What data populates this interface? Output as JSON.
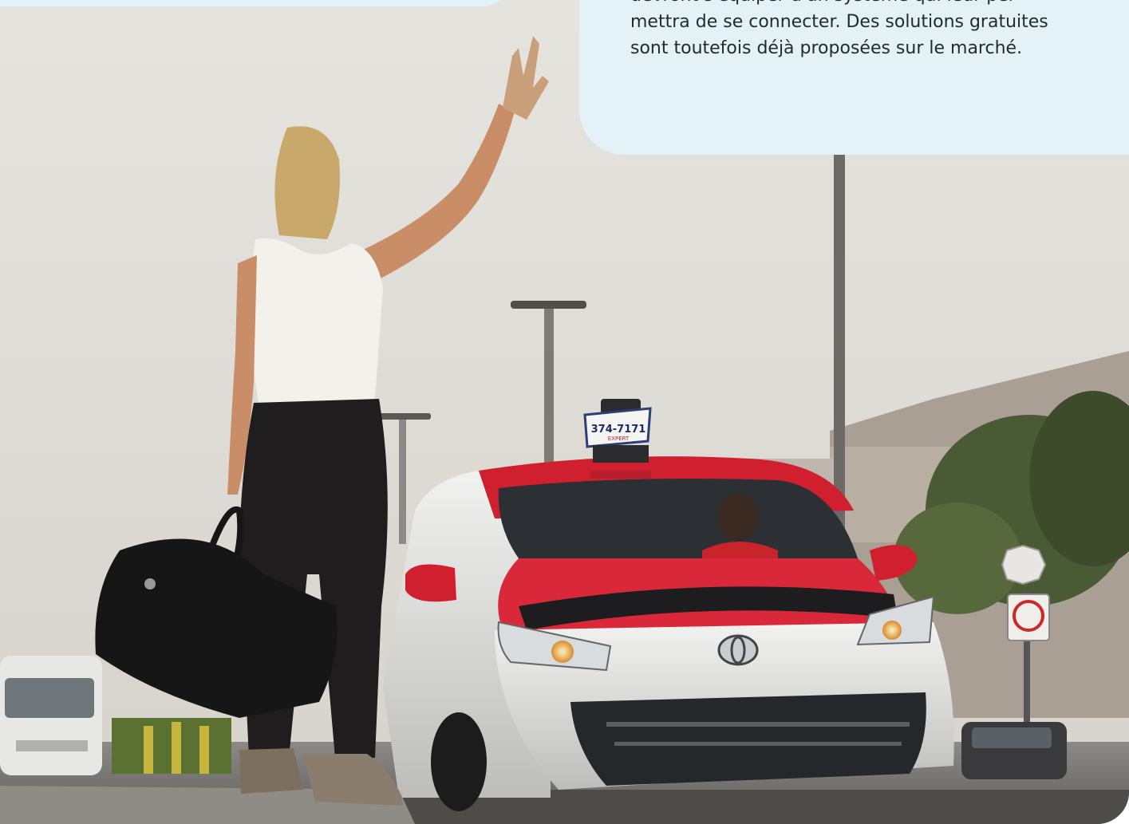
{
  "article": {
    "text_lines": [
      "devront s'équiper d'un système qui leur per-",
      "mettra de se connecter. Des solutions gratuites",
      "sont toutefois déjà proposées sur le marché."
    ]
  },
  "photo": {
    "roof_sign_phone": "374-7171",
    "roof_sign_small": "EXPERT"
  },
  "colors": {
    "callout_bg": "#e4f1f7",
    "taxi_red": "#d0202f",
    "sky": "#dedcd6"
  }
}
